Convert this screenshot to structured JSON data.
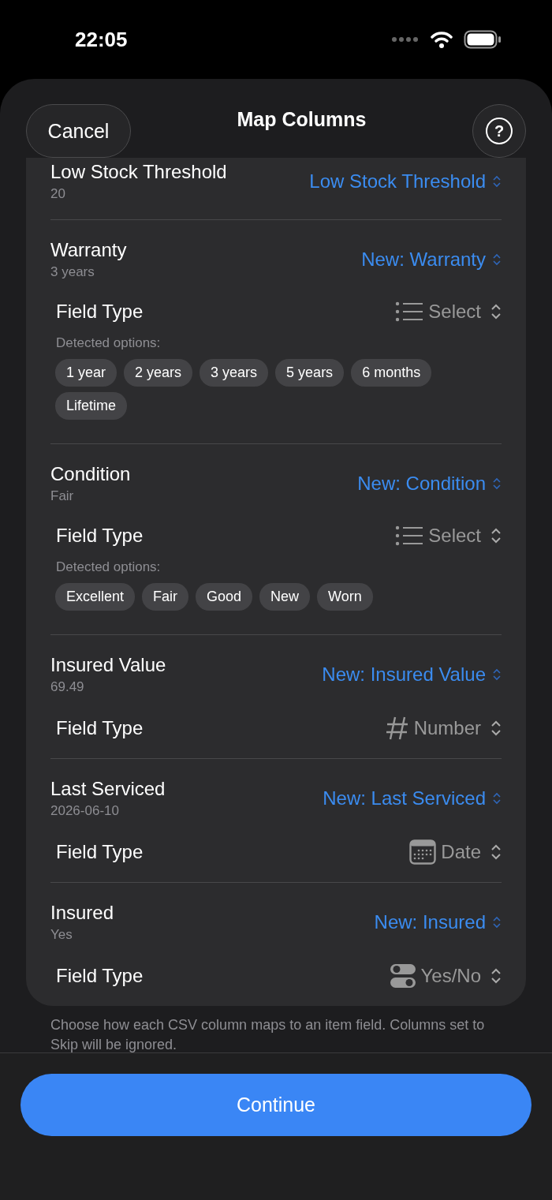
{
  "status_bar": {
    "time": "22:05"
  },
  "nav": {
    "cancel": "Cancel",
    "title": "Map Columns",
    "help": "?"
  },
  "columns": [
    {
      "name": "Low Stock Threshold",
      "sample": "20",
      "mapping": "Low Stock Threshold"
    },
    {
      "name": "Warranty",
      "sample": "3 years",
      "mapping": "New: Warranty",
      "field_type": {
        "label": "Field Type",
        "kind": "select",
        "value": "Select"
      },
      "options_label": "Detected options:",
      "options": [
        "1 year",
        "2 years",
        "3 years",
        "5 years",
        "6 months",
        "Lifetime"
      ]
    },
    {
      "name": "Condition",
      "sample": "Fair",
      "mapping": "New: Condition",
      "field_type": {
        "label": "Field Type",
        "kind": "select",
        "value": "Select"
      },
      "options_label": "Detected options:",
      "options": [
        "Excellent",
        "Fair",
        "Good",
        "New",
        "Worn"
      ]
    },
    {
      "name": "Insured Value",
      "sample": "69.49",
      "mapping": "New: Insured Value",
      "field_type": {
        "label": "Field Type",
        "kind": "number",
        "value": "Number"
      }
    },
    {
      "name": "Last Serviced",
      "sample": "2026-06-10",
      "mapping": "New: Last Serviced",
      "field_type": {
        "label": "Field Type",
        "kind": "date",
        "value": "Date"
      }
    },
    {
      "name": "Insured",
      "sample": "Yes",
      "mapping": "New: Insured",
      "field_type": {
        "label": "Field Type",
        "kind": "toggle",
        "value": "Yes/No"
      }
    }
  ],
  "footer_note": "Choose how each CSV column maps to an item field. Columns set to Skip will be ignored.",
  "continue_button": "Continue"
}
